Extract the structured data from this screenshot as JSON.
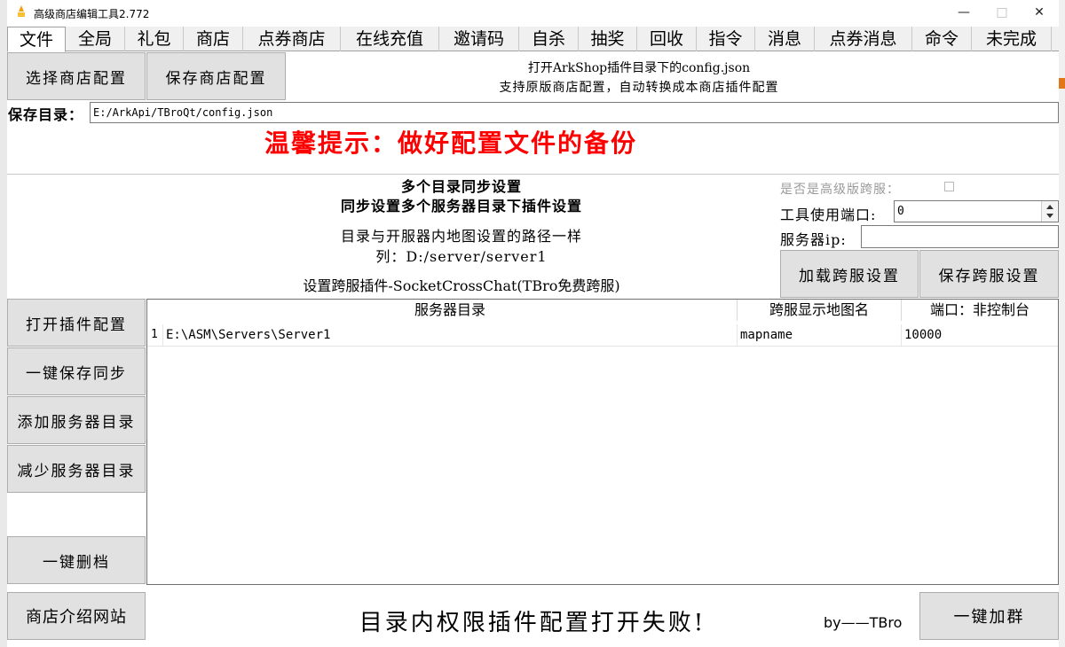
{
  "window": {
    "title": "高级商店编辑工具2.772",
    "controls": {
      "minimize": "—",
      "maximize": "□",
      "close": "✕"
    }
  },
  "tabs": [
    "文件",
    "全局",
    "礼包",
    "商店",
    "点券商店",
    "在线充值",
    "邀请码",
    "自杀",
    "抽奖",
    "回收",
    "指令",
    "消息",
    "点券消息",
    "命令",
    "未完成"
  ],
  "active_tab": "文件",
  "top": {
    "select_config_button": "选择商店配置",
    "save_config_button": "保存商店配置",
    "info_line1": "打开ArkShop插件目录下的config.json",
    "info_line2": "支持原版商店配置，自动转换成本商店插件配置",
    "save_dir_label": "保存目录：",
    "save_dir_value": "E:/ArkApi/TBroQt/config.json",
    "warning": "温馨提示：做好配置文件的备份"
  },
  "sync": {
    "title1": "多个目录同步设置",
    "title2": "同步设置多个服务器目录下插件设置",
    "desc1": "目录与开服器内地图设置的路径一样",
    "desc2": "列：D:/server/server1",
    "plugin_note": "设置跨服插件-SocketCrossChat(TBro免费跨服)"
  },
  "cross": {
    "advanced_label": "是否是高级版跨服：",
    "advanced_checked": false,
    "port_label": "工具使用端口:",
    "port_value": "0",
    "ip_label": "服务器ip:",
    "ip_value": "",
    "load_button": "加载跨服设置",
    "save_button": "保存跨服设置"
  },
  "side_buttons": {
    "open_plugin": "打开插件配置",
    "save_sync": "一键保存同步",
    "add_dir": "添加服务器目录",
    "remove_dir": "减少服务器目录",
    "delete_save": "一键删档"
  },
  "table": {
    "headers": [
      "服务器目录",
      "跨服显示地图名",
      "端口：非控制台"
    ],
    "rows": [
      {
        "index": "1",
        "dir": "E:\\ASM\\Servers\\Server1",
        "map": "mapname",
        "port": "10000"
      }
    ]
  },
  "bottom": {
    "website_button": "商店介绍网站",
    "status": "目录内权限插件配置打开失败!",
    "author": "by——TBro",
    "join_group_button": "一键加群"
  },
  "colors": {
    "warning": "#ff0000",
    "button_bg": "#e1e1e1",
    "orange": "#e0781a"
  }
}
